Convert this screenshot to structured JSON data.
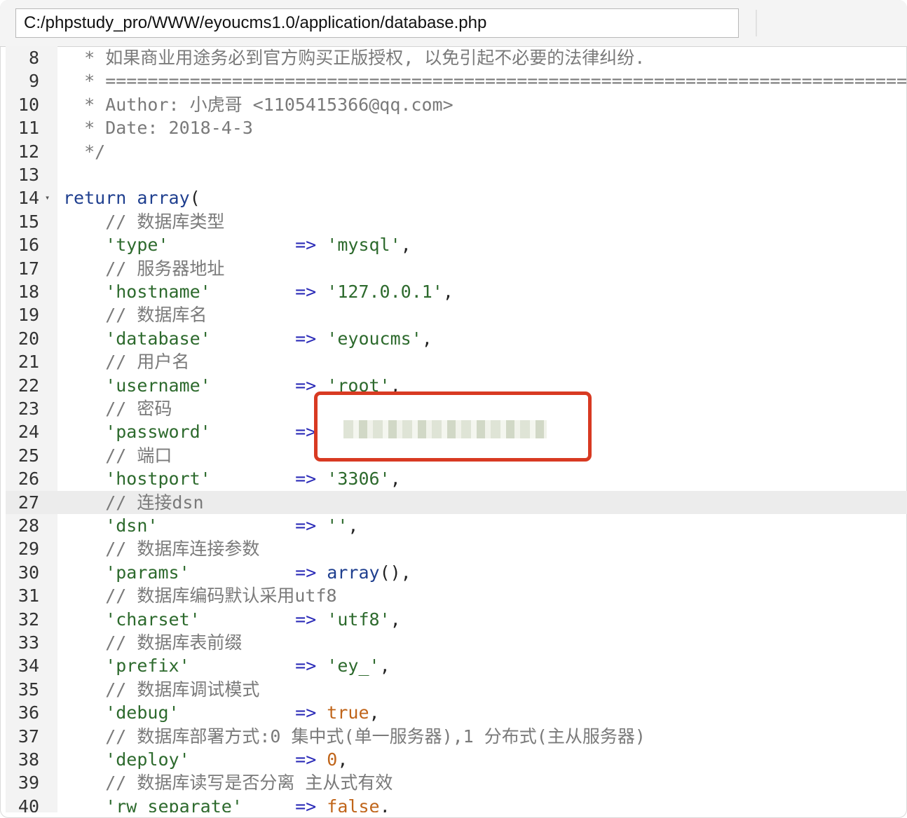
{
  "toolbar": {
    "file_path": "C:/phpstudy_pro/WWW/eyoucms1.0/application/database.php"
  },
  "editor": {
    "current_line": "27",
    "lines": [
      {
        "n": "8",
        "tokens": [
          {
            "t": "  * 如果商业用途务必到官方购买正版授权, 以免引起不必要的法律纠纷.",
            "c": "c-comment"
          }
        ]
      },
      {
        "n": "9",
        "tokens": [
          {
            "t": "  * ====================================================================================",
            "c": "c-comment"
          }
        ]
      },
      {
        "n": "10",
        "tokens": [
          {
            "t": "  * Author: 小虎哥 <1105415366@qq.com>",
            "c": "c-comment"
          }
        ]
      },
      {
        "n": "11",
        "tokens": [
          {
            "t": "  * Date: 2018-4-3",
            "c": "c-comment"
          }
        ]
      },
      {
        "n": "12",
        "tokens": [
          {
            "t": "  */",
            "c": "c-comment"
          }
        ]
      },
      {
        "n": "13",
        "tokens": []
      },
      {
        "n": "14",
        "fold": true,
        "tokens": [
          {
            "t": "return array",
            "c": "c-keyword"
          },
          {
            "t": "(",
            "c": "c-plain"
          }
        ]
      },
      {
        "n": "15",
        "tokens": [
          {
            "t": "    // 数据库类型",
            "c": "c-comment"
          }
        ]
      },
      {
        "n": "16",
        "tokens": [
          {
            "t": "    'type'",
            "c": "c-string"
          },
          {
            "t": "            => ",
            "c": "c-arrow"
          },
          {
            "t": "'mysql'",
            "c": "c-string"
          },
          {
            "t": ",",
            "c": "c-plain"
          }
        ]
      },
      {
        "n": "17",
        "tokens": [
          {
            "t": "    // 服务器地址",
            "c": "c-comment"
          }
        ]
      },
      {
        "n": "18",
        "tokens": [
          {
            "t": "    'hostname'",
            "c": "c-string"
          },
          {
            "t": "        => ",
            "c": "c-arrow"
          },
          {
            "t": "'127.0.0.1'",
            "c": "c-string"
          },
          {
            "t": ",",
            "c": "c-plain"
          }
        ]
      },
      {
        "n": "19",
        "tokens": [
          {
            "t": "    // 数据库名",
            "c": "c-comment"
          }
        ]
      },
      {
        "n": "20",
        "tokens": [
          {
            "t": "    'database'",
            "c": "c-string"
          },
          {
            "t": "        => ",
            "c": "c-arrow"
          },
          {
            "t": "'eyoucms'",
            "c": "c-string"
          },
          {
            "t": ",",
            "c": "c-plain"
          }
        ]
      },
      {
        "n": "21",
        "tokens": [
          {
            "t": "    // 用户名",
            "c": "c-comment"
          }
        ]
      },
      {
        "n": "22",
        "tokens": [
          {
            "t": "    'username'",
            "c": "c-string"
          },
          {
            "t": "        => ",
            "c": "c-arrow"
          },
          {
            "t": "'root'",
            "c": "c-string"
          },
          {
            "t": ",",
            "c": "c-plain"
          }
        ]
      },
      {
        "n": "23",
        "tokens": [
          {
            "t": "    // 密码",
            "c": "c-comment"
          }
        ]
      },
      {
        "n": "24",
        "tokens": [
          {
            "t": "    'password'",
            "c": "c-string"
          },
          {
            "t": "        =>",
            "c": "c-arrow"
          }
        ]
      },
      {
        "n": "25",
        "tokens": [
          {
            "t": "    // 端口",
            "c": "c-comment"
          }
        ]
      },
      {
        "n": "26",
        "tokens": [
          {
            "t": "    'hostport'",
            "c": "c-string"
          },
          {
            "t": "        => ",
            "c": "c-arrow"
          },
          {
            "t": "'3306'",
            "c": "c-string"
          },
          {
            "t": ",",
            "c": "c-plain"
          }
        ]
      },
      {
        "n": "27",
        "tokens": [
          {
            "t": "    // 连接dsn",
            "c": "c-comment"
          }
        ]
      },
      {
        "n": "28",
        "tokens": [
          {
            "t": "    'dsn'",
            "c": "c-string"
          },
          {
            "t": "             => ",
            "c": "c-arrow"
          },
          {
            "t": "''",
            "c": "c-string"
          },
          {
            "t": ",",
            "c": "c-plain"
          }
        ]
      },
      {
        "n": "29",
        "tokens": [
          {
            "t": "    // 数据库连接参数",
            "c": "c-comment"
          }
        ]
      },
      {
        "n": "30",
        "tokens": [
          {
            "t": "    'params'",
            "c": "c-string"
          },
          {
            "t": "          => ",
            "c": "c-arrow"
          },
          {
            "t": "array",
            "c": "c-keyword"
          },
          {
            "t": "(),",
            "c": "c-plain"
          }
        ]
      },
      {
        "n": "31",
        "tokens": [
          {
            "t": "    // 数据库编码默认采用utf8",
            "c": "c-comment"
          }
        ]
      },
      {
        "n": "32",
        "tokens": [
          {
            "t": "    'charset'",
            "c": "c-string"
          },
          {
            "t": "         => ",
            "c": "c-arrow"
          },
          {
            "t": "'utf8'",
            "c": "c-string"
          },
          {
            "t": ",",
            "c": "c-plain"
          }
        ]
      },
      {
        "n": "33",
        "tokens": [
          {
            "t": "    // 数据库表前缀",
            "c": "c-comment"
          }
        ]
      },
      {
        "n": "34",
        "tokens": [
          {
            "t": "    'prefix'",
            "c": "c-string"
          },
          {
            "t": "          => ",
            "c": "c-arrow"
          },
          {
            "t": "'ey_'",
            "c": "c-string"
          },
          {
            "t": ",",
            "c": "c-plain"
          }
        ]
      },
      {
        "n": "35",
        "tokens": [
          {
            "t": "    // 数据库调试模式",
            "c": "c-comment"
          }
        ]
      },
      {
        "n": "36",
        "tokens": [
          {
            "t": "    'debug'",
            "c": "c-string"
          },
          {
            "t": "           => ",
            "c": "c-arrow"
          },
          {
            "t": "true",
            "c": "c-const"
          },
          {
            "t": ",",
            "c": "c-plain"
          }
        ]
      },
      {
        "n": "37",
        "tokens": [
          {
            "t": "    // 数据库部署方式:0 集中式(单一服务器),1 分布式(主从服务器)",
            "c": "c-comment"
          }
        ]
      },
      {
        "n": "38",
        "tokens": [
          {
            "t": "    'deploy'",
            "c": "c-string"
          },
          {
            "t": "          => ",
            "c": "c-arrow"
          },
          {
            "t": "0",
            "c": "c-const"
          },
          {
            "t": ",",
            "c": "c-plain"
          }
        ]
      },
      {
        "n": "39",
        "tokens": [
          {
            "t": "    // 数据库读写是否分离 主从式有效",
            "c": "c-comment"
          }
        ]
      },
      {
        "n": "40",
        "tokens": [
          {
            "t": "    'rw_separate'",
            "c": "c-string"
          },
          {
            "t": "     => ",
            "c": "c-arrow"
          },
          {
            "t": "false",
            "c": "c-const"
          },
          {
            "t": ",",
            "c": "c-plain"
          }
        ]
      }
    ]
  },
  "colors": {
    "highlight_box": "#d83a22",
    "current_line_bg": "#ececec",
    "gutter_bg": "#f3f3f3"
  },
  "icons": {
    "fold": "chevron-down-icon"
  }
}
